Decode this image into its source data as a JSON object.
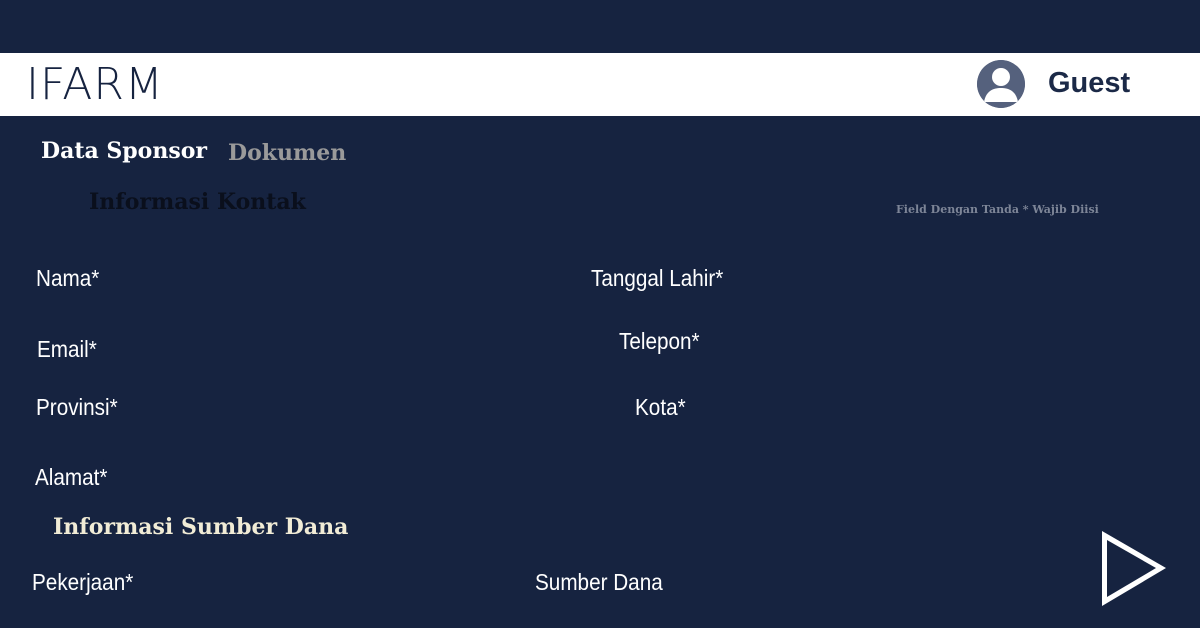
{
  "header": {
    "logo": "IFARM",
    "user_name": "Guest",
    "avatar_icon": "user-avatar-icon"
  },
  "tabs": [
    {
      "label": "Data Sponsor",
      "active": true
    },
    {
      "label": "Dokumen",
      "active": false
    }
  ],
  "contact_section": {
    "title": "Informasi Kontak",
    "required_note": "Field Dengan Tanda * Wajib Diisi",
    "fields": {
      "nama": "Nama*",
      "tanggal_lahir": "Tanggal Lahir*",
      "email": "Email*",
      "telepon": "Telepon*",
      "provinsi": "Provinsi*",
      "kota": "Kota*",
      "alamat": "Alamat*"
    }
  },
  "fund_section": {
    "title": "Informasi Sumber Dana",
    "fields": {
      "pekerjaan": "Pekerjaan*",
      "sumber_dana": "Sumber Dana"
    }
  },
  "next_button_icon": "play-arrow-icon",
  "colors": {
    "background": "#162340",
    "header": "#ffffff",
    "accent_text": "#f1ecd6",
    "inactive_tab": "#9a9a9a"
  }
}
